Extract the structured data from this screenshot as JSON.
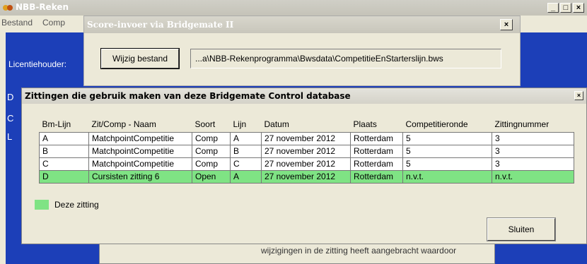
{
  "app": {
    "title": "NBB-Reken",
    "menu": [
      "Bestand",
      "Comp"
    ],
    "licensee_label": "Licentiehouder:",
    "side_letters": [
      "D",
      "C",
      "L"
    ],
    "controls": [
      "_",
      "□",
      "×"
    ]
  },
  "score_window": {
    "title": "Score-invoer via Bridgemate II",
    "close": "×",
    "wijzig_button": "Wijzig bestand",
    "path": "...a\\NBB-Rekenprogramma\\Bwsdata\\CompetitieEnStarterslijn.bws"
  },
  "background_text": "wijzigingen in de zitting heeft aangebracht waardoor",
  "dialog": {
    "title": "Zittingen die gebruik maken van deze Bridgemate Control database",
    "close": "×",
    "columns": [
      "Bm-Lijn",
      "Zit/Comp - Naam",
      "Soort",
      "Lijn",
      "Datum",
      "Plaats",
      "Competitieronde",
      "Zittingnummer"
    ],
    "rows": [
      [
        "A",
        "MatchpointCompetitie",
        "Comp",
        "A",
        "27 november 2012",
        "Rotterdam",
        "5",
        "3"
      ],
      [
        "B",
        "MatchpointCompetitie",
        "Comp",
        "B",
        "27 november 2012",
        "Rotterdam",
        "5",
        "3"
      ],
      [
        "C",
        "MatchpointCompetitie",
        "Comp",
        "C",
        "27 november 2012",
        "Rotterdam",
        "5",
        "3"
      ],
      [
        "D",
        "Cursisten zitting 6",
        "Open",
        "A",
        "27 november 2012",
        "Rotterdam",
        "n.v.t.",
        "n.v.t."
      ]
    ],
    "current_row_index": 3,
    "legend_label": "Deze zitting",
    "close_button": "Sluiten"
  },
  "colors": {
    "highlight": "#7fe384",
    "app_body": "#1c3fb8",
    "window_face": "#ece9d8"
  }
}
